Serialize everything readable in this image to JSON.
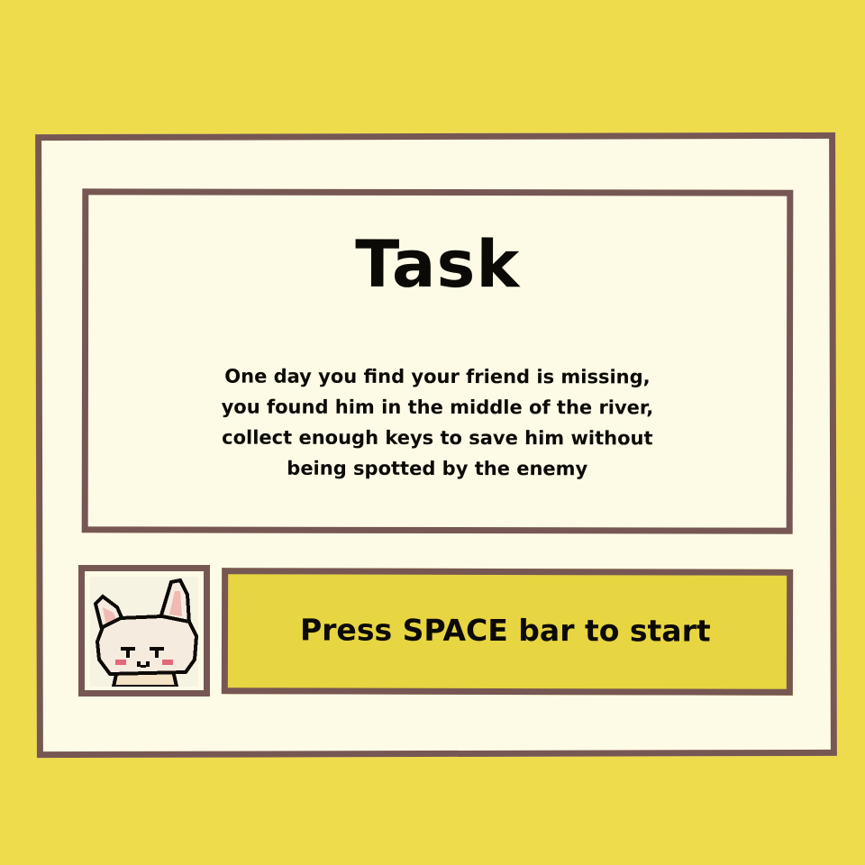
{
  "colors": {
    "background": "#efdc4c",
    "panel": "#fdfbe6",
    "border": "#775753",
    "button": "#e7d541",
    "text": "#0c0a06"
  },
  "task": {
    "title": "Task",
    "lines": [
      "One day you find your friend is missing,",
      "you found him in the middle of the river,",
      "collect enough keys to save him without",
      "being spotted by the enemy"
    ]
  },
  "portrait": {
    "icon": "cat-face-icon"
  },
  "start": {
    "label": "Press SPACE bar to start"
  }
}
